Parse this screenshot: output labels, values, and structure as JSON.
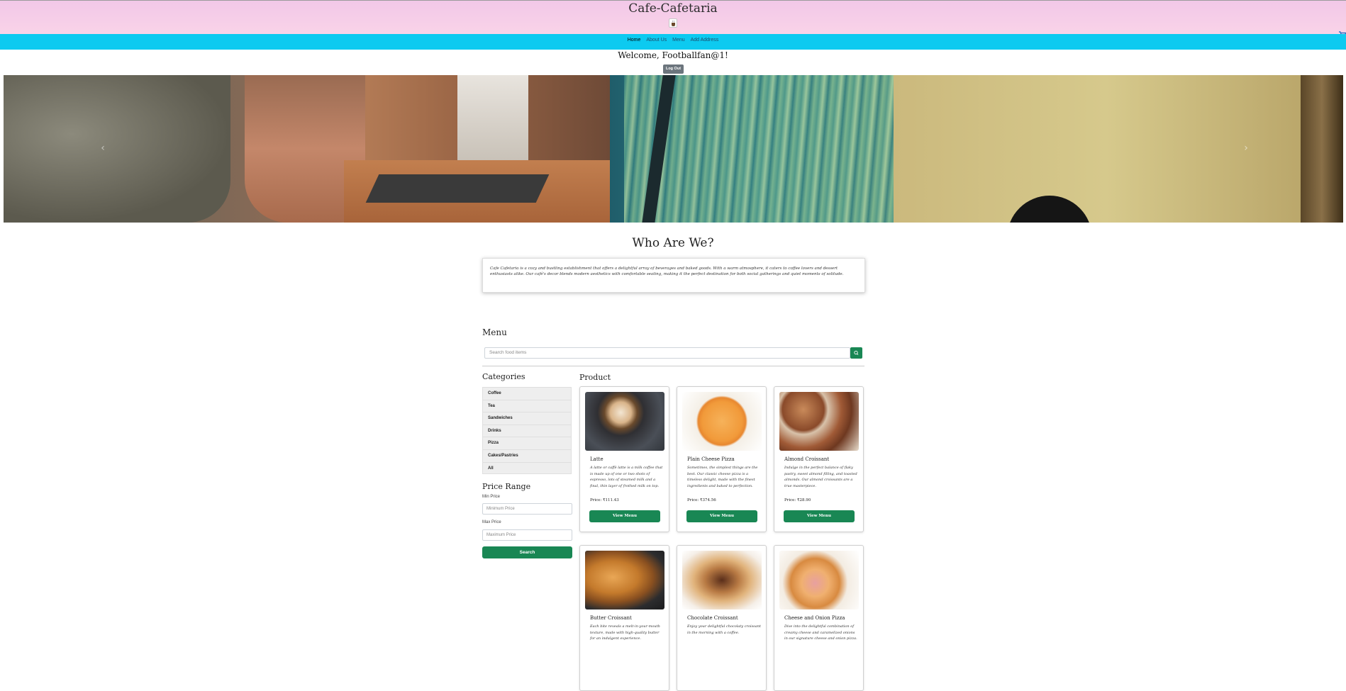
{
  "header": {
    "brand": "Cafe-Cafetaria"
  },
  "nav": {
    "items": [
      "Home",
      "About Us",
      "Menu",
      "Add Address"
    ]
  },
  "user": {
    "welcome": "Welcome, Footballfan@1!",
    "logout_label": "Log Out"
  },
  "carousel": {
    "prev_icon": "chevron-left-icon",
    "next_icon": "chevron-right-icon"
  },
  "about": {
    "title": "Who Are We?",
    "text": "Cafe Cafetaria is a cozy and bustling establishment that offers a delightful array of beverages and baked goods. With a warm atmosphere, it caters to coffee lovers and dessert enthusiasts alike. Our café's decor blends modern aesthetics with comfortable seating, making it the perfect destination for both social gatherings and quiet moments of solitude."
  },
  "menu": {
    "title": "Menu",
    "search_placeholder": "Search food items"
  },
  "categories": {
    "title": "Categories",
    "items": [
      "Coffee",
      "Tea",
      "Sandwiches",
      "Drinks",
      "Pizza",
      "Cakes/Pastries",
      "All"
    ]
  },
  "price_range": {
    "title": "Price Range",
    "min_label": "Min Price",
    "min_placeholder": "Minimum Price",
    "max_label": "Max Price",
    "max_placeholder": "Maximum Price",
    "search_label": "Search"
  },
  "products": {
    "title": "Product",
    "view_label": "View Menu",
    "items": [
      {
        "name": "Latte",
        "desc": "A latte or caffè latte is a milk coffee that is made up of one or two shots of espresso, lots of steamed milk and a final, thin layer of frothed milk on top.",
        "price": "Price: ₹111.43"
      },
      {
        "name": "Plain Cheese Pizza",
        "desc": "Sometimes, the simplest things are the best. Our classic cheese pizza is a timeless delight, made with the finest ingredients and baked to perfection.",
        "price": "Price: ₹374.56"
      },
      {
        "name": "Almond Croissant",
        "desc": "Indulge in the perfect balance of flaky pastry, sweet almond filling, and toasted almonds. Our almond croissants are a true masterpiece.",
        "price": "Price: ₹28.90"
      },
      {
        "name": "Butter Croissant",
        "desc": "Each bite reveals a melt-in-your-mouth texture, made with high-quality butter for an indulgent experience.",
        "price": ""
      },
      {
        "name": "Chocolate Croissant",
        "desc": "Enjoy your delightful chocolaty croissant in the morning with a coffee.",
        "price": ""
      },
      {
        "name": "Cheese and Onion Pizza",
        "desc": "Dive into the delightful combination of creamy cheese and caramelized onions in our signature cheese and onion pizza.",
        "price": ""
      }
    ]
  }
}
